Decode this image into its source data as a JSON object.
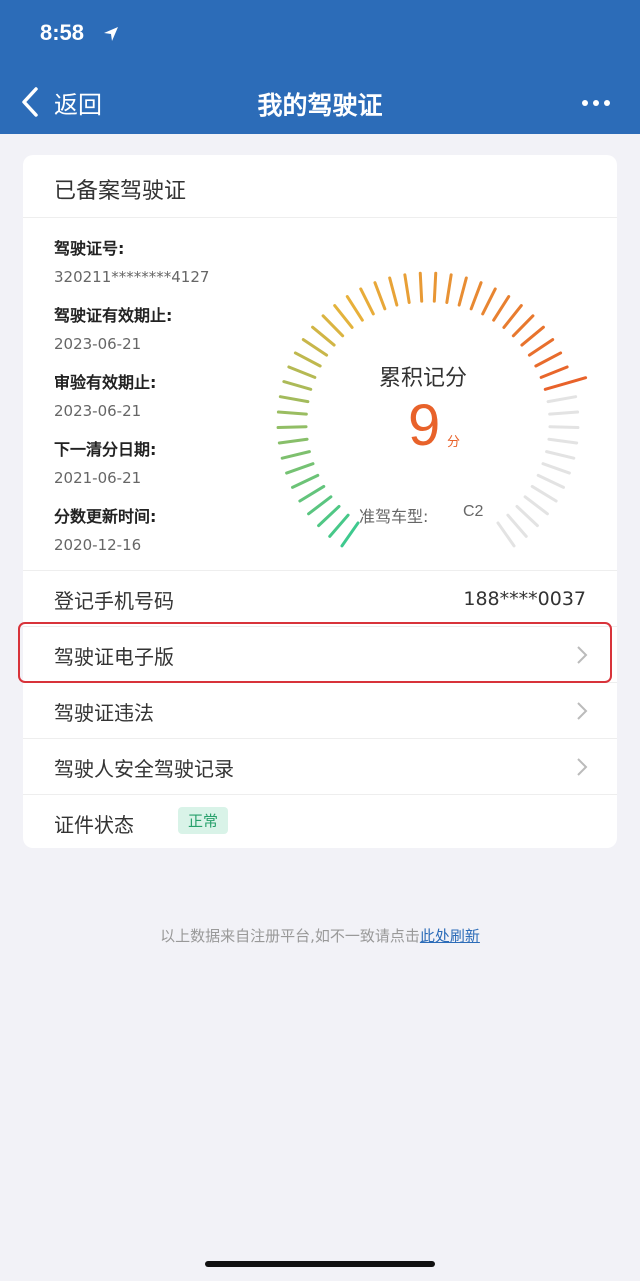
{
  "status_bar": {
    "time": "8:58"
  },
  "nav": {
    "back_label": "返回",
    "title": "我的驾驶证"
  },
  "card": {
    "title": "已备案驾驶证",
    "info": [
      {
        "label": "驾驶证号:",
        "value": "320211********4127"
      },
      {
        "label": "驾驶证有效期止:",
        "value": "2023-06-21"
      },
      {
        "label": "审验有效期止:",
        "value": "2023-06-21"
      },
      {
        "label": "下一清分日期:",
        "value": "2021-06-21"
      },
      {
        "label": "分数更新时间:",
        "value": "2020-12-16"
      }
    ],
    "gauge": {
      "title": "累积记分",
      "score": "9",
      "unit": "分",
      "max_score": 12,
      "car_type_label": "准驾车型:",
      "car_type_value": "C2",
      "colors": {
        "start": "#3ec98e",
        "mid": "#e8b23a",
        "end": "#e8622a",
        "inactive": "#e3e3e3"
      }
    },
    "rows": {
      "phone_label": "登记手机号码",
      "phone_value": "188****0037",
      "ecard_label": "驾驶证电子版",
      "violation_label": "驾驶证违法",
      "safety_label": "驾驶人安全驾驶记录",
      "status_label": "证件状态",
      "status_value": "正常"
    }
  },
  "footer": {
    "note": "以上数据来自注册平台,如不一致请点击",
    "link": "此处刷新"
  },
  "colors": {
    "header": "#2c6cb8",
    "highlight": "#d8333a",
    "accent": "#e8622a",
    "badge_text": "#27a06b"
  }
}
